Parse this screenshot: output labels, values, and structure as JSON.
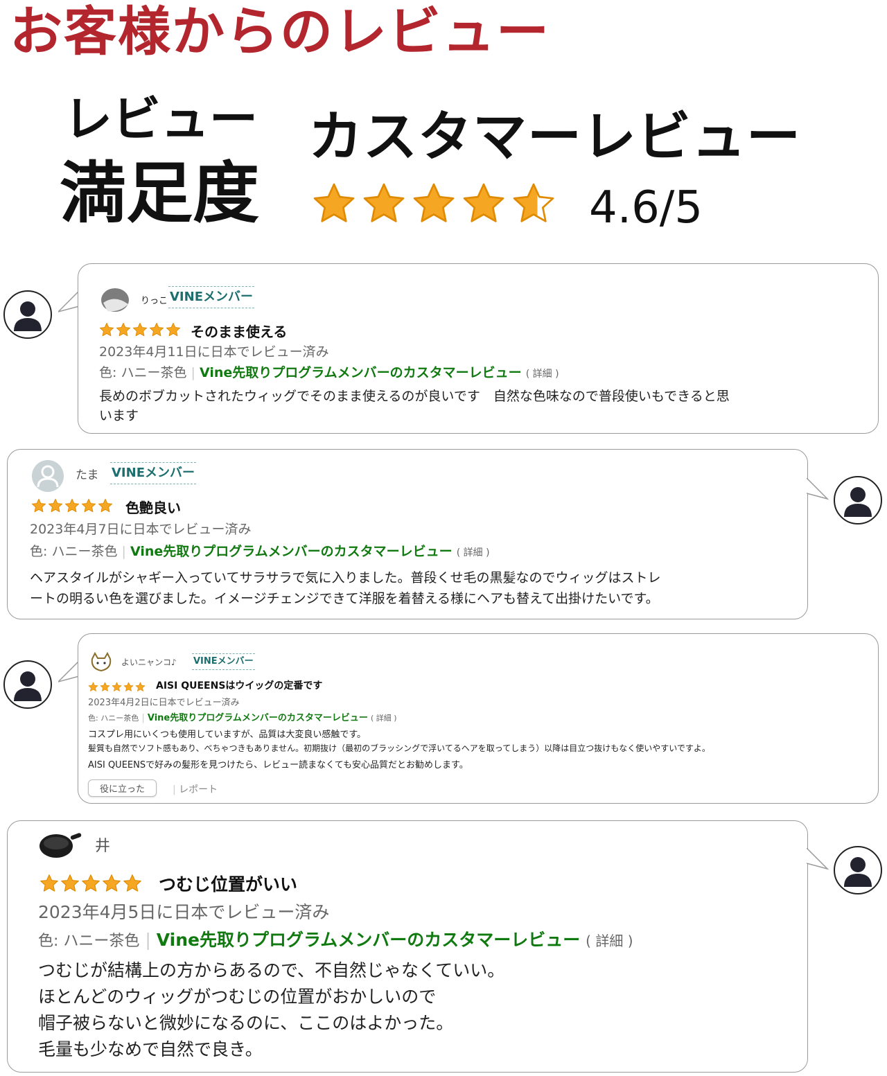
{
  "heading": "お客様からのレビュー",
  "satisfaction": {
    "line1": "レビュー",
    "line2": "満足度"
  },
  "customer": {
    "title": "カスタマーレビュー",
    "rating_text": "4.6/5",
    "rating": 4.6,
    "max": 5
  },
  "colors": {
    "heading": "#b3262d",
    "star": "#f5a623",
    "vine_green": "#107a10",
    "vine_badge": "#1d6e6e"
  },
  "reviews": [
    {
      "user": "りっこ",
      "badge": "VINEメンバー",
      "stars": 5,
      "title": "そのまま使える",
      "date": "2023年4月11日に日本でレビュー済み",
      "color": "色: ハニー茶色",
      "vine": "Vine先取りプログラムメンバーのカスタマーレビュー",
      "details": "( 詳細 )",
      "lines": [
        "長めのボブカットされたウィッグでそのまま使えるのが良いです　自然な色味なので普段使いもできると思",
        "います"
      ]
    },
    {
      "user": "たま",
      "badge": "VINEメンバー",
      "stars": 5,
      "title": "色艶良い",
      "date": "2023年4月7日に日本でレビュー済み",
      "color": "色: ハニー茶色",
      "vine": "Vine先取りプログラムメンバーのカスタマーレビュー",
      "details": "( 詳細 )",
      "lines": [
        "ヘアスタイルがシャギー入っていてサラサラで気に入りました。普段くせ毛の黒髪なのでウィッグはストレ",
        "ートの明るい色を選びました。イメージチェンジできて洋服を着替える様にヘアも替えて出掛けたいです。"
      ]
    },
    {
      "user": "よいニャンコ♪",
      "badge": "VINEメンバー",
      "stars": 5,
      "title": "AISI QUEENSはウイッグの定番です",
      "date": "2023年4月2日に日本でレビュー済み",
      "color": "色: ハニー茶色",
      "vine": "Vine先取りプログラムメンバーのカスタマーレビュー",
      "details": "( 詳細 )",
      "lines": [
        "コスプレ用にいくつも使用していますが、品質は大変良い感触です。",
        "髪質も自然でソフト感もあり、べちゃつきもありません。初期抜け（最初のブラッシングで浮いてるヘアを取ってしまう）以降は目立つ抜けもなく使いやすいですよ。",
        "AISI QUEENSで好みの髪形を見つけたら、レビュー読まなくても安心品質だとお勧めします。"
      ],
      "helpful": "役に立った",
      "report": "レポート"
    },
    {
      "user": "井",
      "stars": 5,
      "title": "つむじ位置がいい",
      "date": "2023年4月5日に日本でレビュー済み",
      "color": "色: ハニー茶色",
      "vine": "Vine先取りプログラムメンバーのカスタマーレビュー",
      "details": "( 詳細 )",
      "lines": [
        "つむじが結構上の方からあるので、不自然じゃなくていい。",
        "ほとんどのウィッグがつむじの位置がおかしいので",
        "帽子被らないと微妙になるのに、ここのはよかった。",
        "毛量も少なめで自然で良き。"
      ]
    }
  ]
}
